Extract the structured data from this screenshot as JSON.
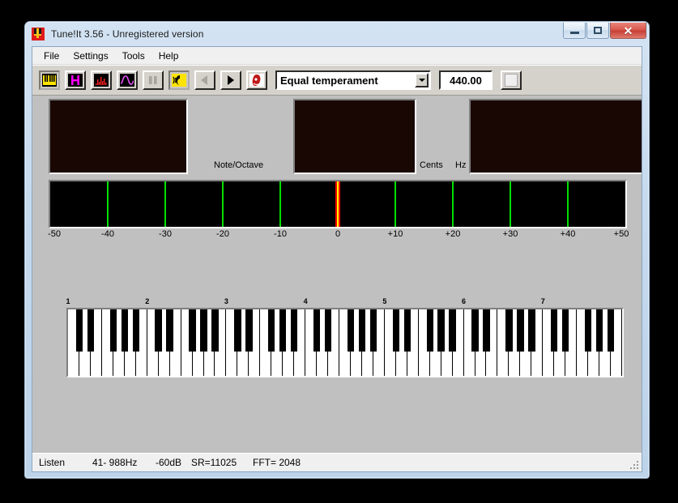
{
  "window": {
    "title": "Tune!It 3.56  -  Unregistered version",
    "icon": "tuning-fork-icon",
    "buttons": {
      "minimize": "minimize-icon",
      "maximize": "restore-icon",
      "close": "✕"
    }
  },
  "menu": {
    "items": [
      {
        "label": "File"
      },
      {
        "label": "Settings"
      },
      {
        "label": "Tools"
      },
      {
        "label": "Help"
      }
    ]
  },
  "toolbar": {
    "buttons": [
      {
        "name": "keyboard-view-button",
        "icon": "piano-keyboard-icon",
        "state": "pressed"
      },
      {
        "name": "harmonic-view-button",
        "icon": "letter-h-icon",
        "state": "normal"
      },
      {
        "name": "spectrum-view-button",
        "icon": "spectrum-bars-icon",
        "state": "normal"
      },
      {
        "name": "waveform-view-button",
        "icon": "sine-wave-icon",
        "state": "normal"
      },
      {
        "name": "pause-button",
        "icon": "pause-icon",
        "state": "disabled"
      },
      {
        "name": "listen-button",
        "icon": "ear-listen-icon",
        "state": "pressed"
      },
      {
        "name": "previous-button",
        "icon": "left-triangle-icon",
        "state": "disabled"
      },
      {
        "name": "next-button",
        "icon": "right-triangle-icon",
        "state": "normal"
      },
      {
        "name": "about-button",
        "icon": "face-portrait-icon",
        "state": "normal"
      }
    ],
    "temperament": {
      "selected": "Equal temperament",
      "options": [
        "Equal temperament"
      ]
    },
    "reference_frequency": "440.00",
    "blank_button_label": ""
  },
  "display": {
    "note_octave_value": "",
    "cents_value": "",
    "hz_value": "",
    "labels": {
      "note_octave": "Note/Octave",
      "cents": "Cents",
      "hz": "Hz"
    },
    "panel_bg": "#190704"
  },
  "meter": {
    "ticks": [
      "-50",
      "-40",
      "-30",
      "-20",
      "-10",
      "0",
      "+10",
      "+20",
      "+30",
      "+40",
      "+50"
    ],
    "gridline_values": [
      -40,
      -30,
      -20,
      -10,
      10,
      20,
      30,
      40
    ],
    "range": [
      -50,
      50
    ],
    "needle_value": 0,
    "gridline_color": "#00e000",
    "needle_color": "#ff0000",
    "needle_core_color": "#ffff00",
    "background": "#000000"
  },
  "keyboard": {
    "octave_labels": [
      "1",
      "2",
      "3",
      "4",
      "5",
      "6",
      "7"
    ],
    "octave_count": 7,
    "keys_per_octave_white": 7,
    "black_key_pattern": [
      0,
      1,
      3,
      4,
      5
    ],
    "white_key_color": "#ffffff",
    "black_key_color": "#000000"
  },
  "status_bar": {
    "mode": "Listen",
    "range": "41-  988Hz",
    "db": "-60dB",
    "sample_rate": "SR=11025",
    "fft": "FFT= 2048"
  }
}
